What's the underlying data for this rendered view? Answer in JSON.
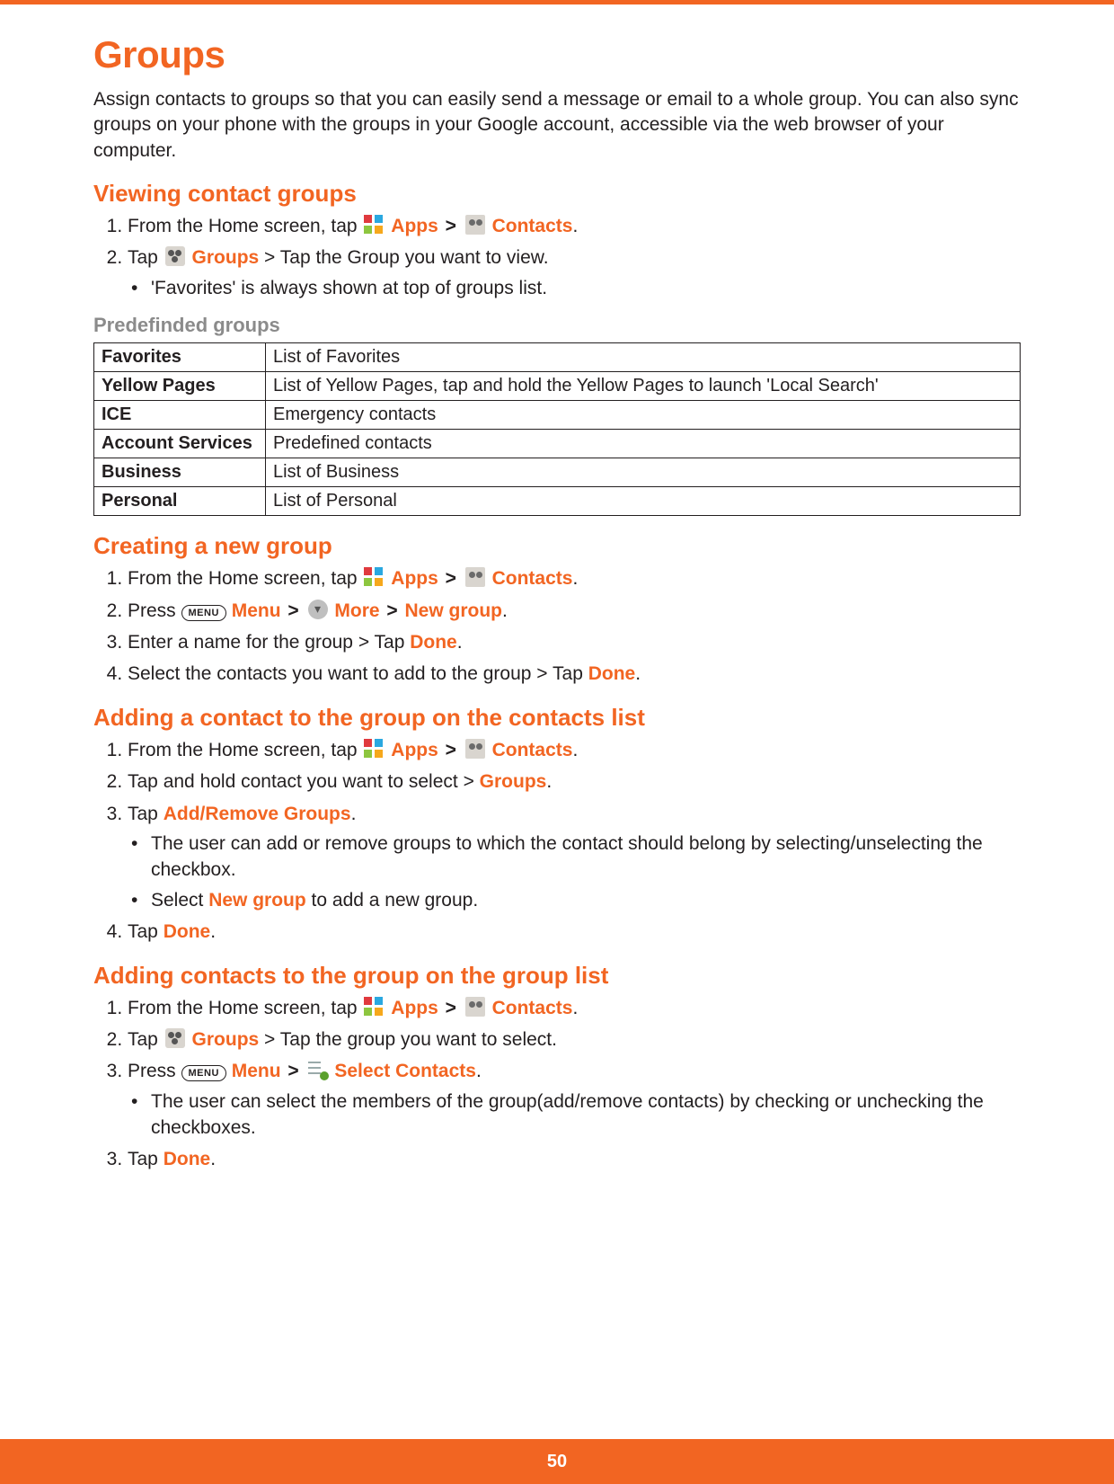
{
  "header": {
    "title": "Groups"
  },
  "intro": "Assign contacts to groups so that you can easily send a message or email to a whole group. You can also sync groups on your phone with the groups in your Google account, accessible via the web browser of your computer.",
  "labels": {
    "apps": "Apps",
    "contacts": "Contacts",
    "groups": "Groups",
    "menu": "Menu",
    "more": "More",
    "new_group": "New group",
    "done": "Done",
    "add_remove_groups": "Add/Remove Groups",
    "select_contacts": "Select Contacts",
    "menu_key": "MENU"
  },
  "viewing": {
    "heading": "Viewing contact groups",
    "step1_pre": "From the Home screen, tap ",
    "step1_gt1": " > ",
    "step1_post": ".",
    "step2_pre": "Tap ",
    "step2_mid": " > Tap the Group you want to view.",
    "bullet1": "'Favorites' is always shown at top of groups list."
  },
  "predef": {
    "heading": "Predefinded groups",
    "rows": [
      {
        "name": "Favorites",
        "desc": "List of Favorites"
      },
      {
        "name": "Yellow Pages",
        "desc": "List of  Yellow Pages, tap and hold the Yellow Pages to launch 'Local Search'"
      },
      {
        "name": "ICE",
        "desc": "Emergency contacts"
      },
      {
        "name": "Account Services",
        "desc": "Predefined contacts"
      },
      {
        "name": "Business",
        "desc": "List of Business"
      },
      {
        "name": "Personal",
        "desc": "List of Personal"
      }
    ]
  },
  "creating": {
    "heading": "Creating a new group",
    "step1_pre": "From the Home screen, tap ",
    "step2_pre": "Press ",
    "step2_gt1": " > ",
    "step2_gt2": " > ",
    "step2_post": ".",
    "step3_pre": "Enter a name for the group > Tap ",
    "step3_post": ".",
    "step4_pre": "Select the contacts you want to add to the group > Tap ",
    "step4_post": "."
  },
  "adding_contact": {
    "heading": "Adding a contact to the group on the contacts list",
    "step1_pre": "From the Home screen, tap ",
    "step2_pre": "Tap and hold contact you want to select > ",
    "step2_post": ".",
    "step3_pre": "Tap ",
    "step3_post": ".",
    "bullet1": "The user can add or remove groups to which the contact should belong by selecting/unselecting the checkbox.",
    "bullet2_pre": "Select ",
    "bullet2_post": " to add a new group.",
    "step4_pre": "Tap ",
    "step4_post": "."
  },
  "adding_contacts_group": {
    "heading": "Adding contacts to the group on the group list",
    "step1_pre": "From the Home screen, tap ",
    "step2_pre": "Tap ",
    "step2_mid": " > Tap the group you want to select.",
    "step3_pre": "Press ",
    "step3_gt1": " > ",
    "step3_post": ".",
    "bullet1": "The user can select the members of the group(add/remove contacts) by checking or unchecking the checkboxes.",
    "step4_pre": "Tap ",
    "step4_post": "."
  },
  "footer": {
    "page_number": "50"
  }
}
